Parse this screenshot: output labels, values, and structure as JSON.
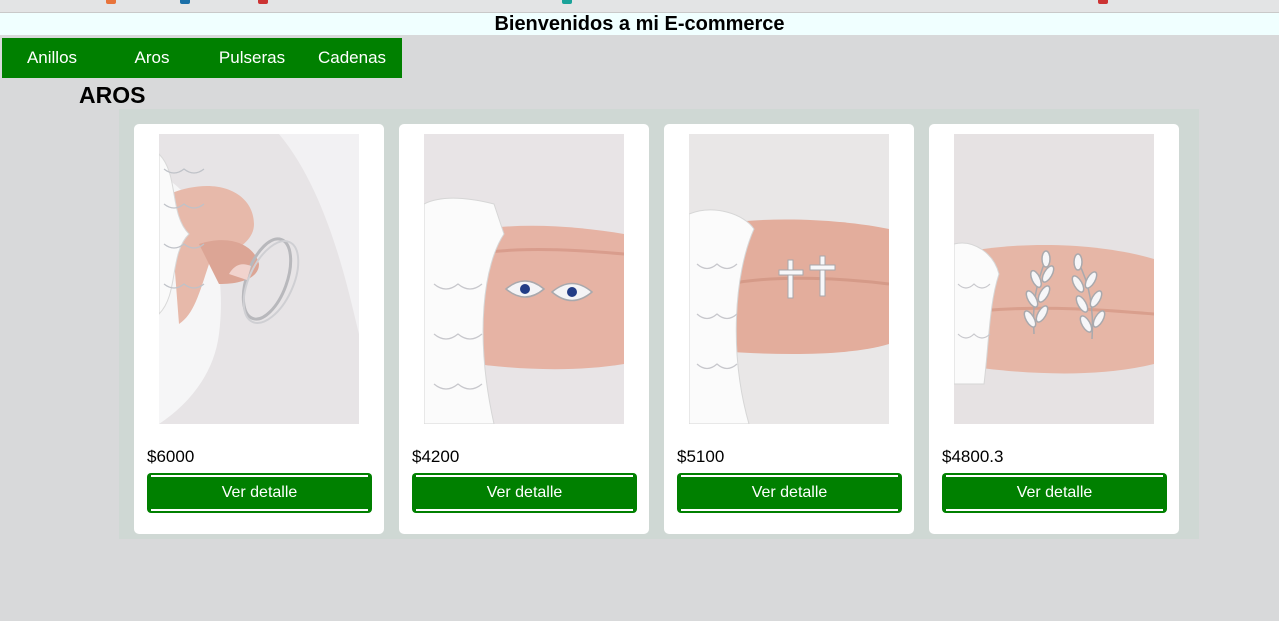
{
  "header": {
    "title": "Bienvenidos a mi E-commerce"
  },
  "nav": {
    "items": [
      "Anillos",
      "Aros",
      "Pulseras",
      "Cadenas"
    ]
  },
  "section": {
    "title": "AROS"
  },
  "products": [
    {
      "image": "ring-photo",
      "price": "$6000",
      "button": "Ver detalle"
    },
    {
      "image": "eye-earrings-photo",
      "price": "$4200",
      "button": "Ver detalle"
    },
    {
      "image": "cross-earrings-photo",
      "price": "$5100",
      "button": "Ver detalle"
    },
    {
      "image": "leaf-earrings-photo",
      "price": "$4800.3",
      "button": "Ver detalle"
    }
  ],
  "colors": {
    "accent": "#008000",
    "background": "#d8d9da",
    "header_bg": "#f0ffff",
    "panel_bg": "#cfd8d4"
  }
}
